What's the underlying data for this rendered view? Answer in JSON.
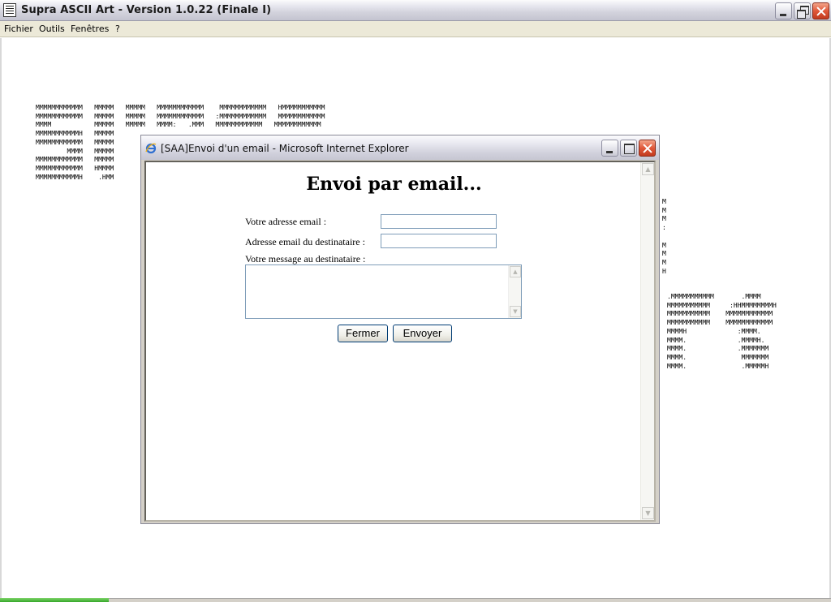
{
  "window": {
    "title": "Supra ASCII Art - Version 1.0.22 (Finale I)"
  },
  "menu": {
    "items": [
      {
        "label": "Fichier"
      },
      {
        "label": "Outils"
      },
      {
        "label": "Fenêtres"
      },
      {
        "label": "?"
      }
    ]
  },
  "ascii_art": {
    "left_block": "MMMMMMMMMMMM   MMMMM   MMMMM   MMMMMMMMMMMM    MMMMMMMMMMMM   HMMMMMMMMMMM\nMMMMMMMMMMMM   MMMMM   MMMMM   MMMMMMMMMMMM   :MMMMMMMMMMMM   MMMMMMMMMMMM\nMMMM           MMMMM   MMMMM   MMMM:   .MMM   MMMMMMMMMMMM   MMMMMMMMMMMM\nMMMMMMMMMMMH   MMMMM\nMMMMMMMMMMMM   MMMMM\n        MMMM   MMMMM\nMMMMMMMMMMMM   MMMMM\nMMMMMMMMMMMM   HMMMM\nMMMMMMMMMMMH    .HMM",
    "mid_right": "M\nM\nM\n:\n\nM\nM\nM\nH",
    "right_block": ".MMMMMMMMMMM       .MMMM\nMMMMMMMMMMM     :HHMMMMMMMMH\nMMMMMMMMMMM    MMMMMMMMMMMM\nMMMMMMMMMMM    MMMMMMMMMMMM\nMMMMH             :MMMM.\nMMMM.             .MMMMH.\nMMMM.             .MMMMMMM\nMMMM.              MMMMMMM\nMMMM.              .MMMMMH"
  },
  "popup": {
    "title": "[SAA]Envoi d'un email - Microsoft Internet Explorer",
    "heading": "Envoi par email...",
    "labels": {
      "sender": "Votre adresse email :",
      "recipient": "Adresse email du destinataire :",
      "message": "Votre message au destinataire :"
    },
    "values": {
      "sender": "",
      "recipient": "",
      "message": ""
    },
    "buttons": {
      "close": "Fermer",
      "send": "Envoyer"
    }
  },
  "colors": {
    "menubar_bg": "#ece9d8",
    "popup_frame": "#d4d0c8",
    "close_button": "#e0583a"
  }
}
